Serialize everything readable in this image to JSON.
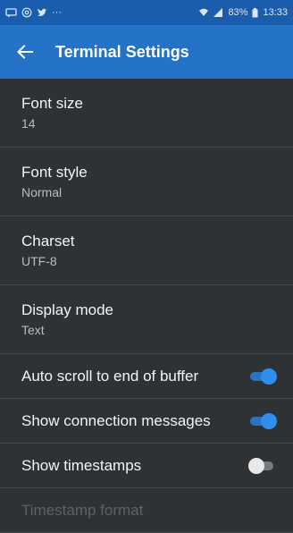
{
  "status_bar": {
    "left_icons": [
      "message-icon",
      "at-icon",
      "twitter-icon"
    ],
    "dots": "···",
    "battery_percent": "83%",
    "time": "13:33"
  },
  "app_bar": {
    "title": "Terminal Settings"
  },
  "settings": [
    {
      "title": "Font size",
      "summary": "14"
    },
    {
      "title": "Font style",
      "summary": "Normal"
    },
    {
      "title": "Charset",
      "summary": "UTF-8"
    },
    {
      "title": "Display mode",
      "summary": "Text"
    },
    {
      "title": "Auto scroll to end of buffer",
      "enabled": true
    },
    {
      "title": "Show connection messages",
      "enabled": true
    },
    {
      "title": "Show timestamps",
      "enabled": false
    },
    {
      "title": "Timestamp format"
    }
  ],
  "colors": {
    "status_bar": "#1a5dad",
    "app_bar": "#2473c9",
    "background": "#2f3234",
    "accent": "#2f8ef0"
  }
}
